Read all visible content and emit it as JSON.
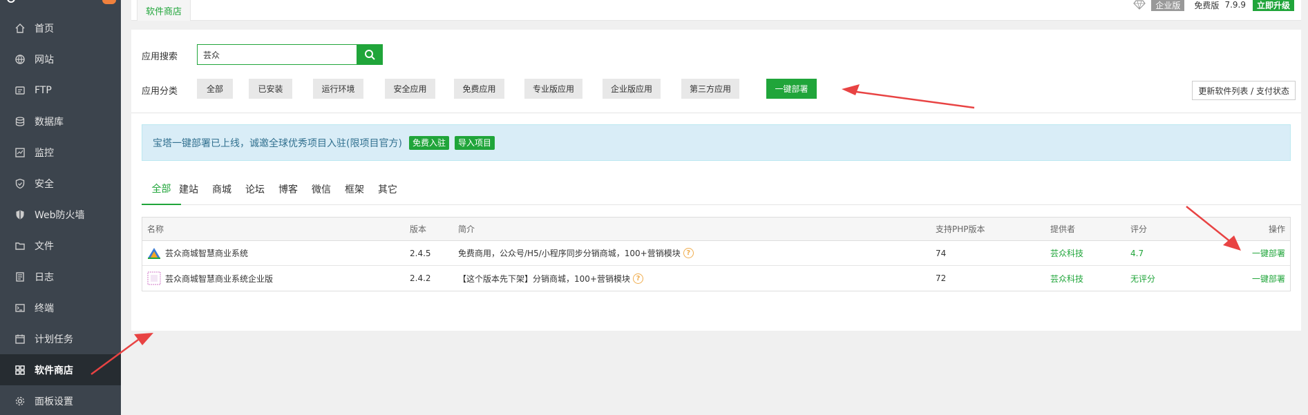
{
  "sidebar": {
    "items": [
      {
        "label": "首页",
        "icon": "home-icon"
      },
      {
        "label": "网站",
        "icon": "globe-icon"
      },
      {
        "label": "FTP",
        "icon": "ftp-icon"
      },
      {
        "label": "数据库",
        "icon": "database-icon"
      },
      {
        "label": "监控",
        "icon": "monitor-icon"
      },
      {
        "label": "安全",
        "icon": "shield-icon"
      },
      {
        "label": "Web防火墙",
        "icon": "firewall-icon"
      },
      {
        "label": "文件",
        "icon": "folder-icon"
      },
      {
        "label": "日志",
        "icon": "log-icon"
      },
      {
        "label": "终端",
        "icon": "terminal-icon"
      },
      {
        "label": "计划任务",
        "icon": "calendar-icon"
      },
      {
        "label": "软件商店",
        "icon": "grid-icon"
      },
      {
        "label": "面板设置",
        "icon": "gear-icon"
      }
    ],
    "active_index": 11
  },
  "topbar": {
    "tab_label": "软件商店",
    "edition_badge": "企业版",
    "version_name": "免费版",
    "version_num": "7.9.9",
    "upgrade_label": "立即升级"
  },
  "search": {
    "label": "应用搜索",
    "value": "芸众"
  },
  "categories": {
    "label": "应用分类",
    "items": [
      "全部",
      "已安装",
      "运行环境",
      "安全应用",
      "免费应用",
      "专业版应用",
      "企业版应用",
      "第三方应用",
      "一键部署"
    ],
    "active_index": 8,
    "update_label": "更新软件列表 / 支付状态"
  },
  "notice": {
    "text": "宝塔一键部署已上线，诚邀全球优秀项目入驻(限项目官方)",
    "btn_join": "免费入驻",
    "btn_import": "导入项目"
  },
  "tabs": {
    "items": [
      "全部",
      "建站",
      "商城",
      "论坛",
      "博客",
      "微信",
      "框架",
      "其它"
    ],
    "active_index": 0
  },
  "table": {
    "headers": {
      "name": "名称",
      "version": "版本",
      "desc": "简介",
      "php": "支持PHP版本",
      "provider": "提供者",
      "score": "评分",
      "action": "操作"
    },
    "rows": [
      {
        "name": "芸众商城智慧商业系统",
        "version": "2.4.5",
        "desc": "免费商用，公众号/H5/小程序同步分销商城，100+营销模块",
        "php": "74",
        "provider": "芸众科技",
        "score": "4.7",
        "action": "一键部署"
      },
      {
        "name": "芸众商城智慧商业系统企业版",
        "version": "2.4.2",
        "desc": "【这个版本先下架】分销商城，100+营销模块",
        "php": "72",
        "provider": "芸众科技",
        "score": "无评分",
        "action": "一键部署"
      }
    ]
  },
  "colors": {
    "accent": "#20a53a",
    "sidebar_bg": "#3c444d",
    "arrow": "#e84343"
  }
}
